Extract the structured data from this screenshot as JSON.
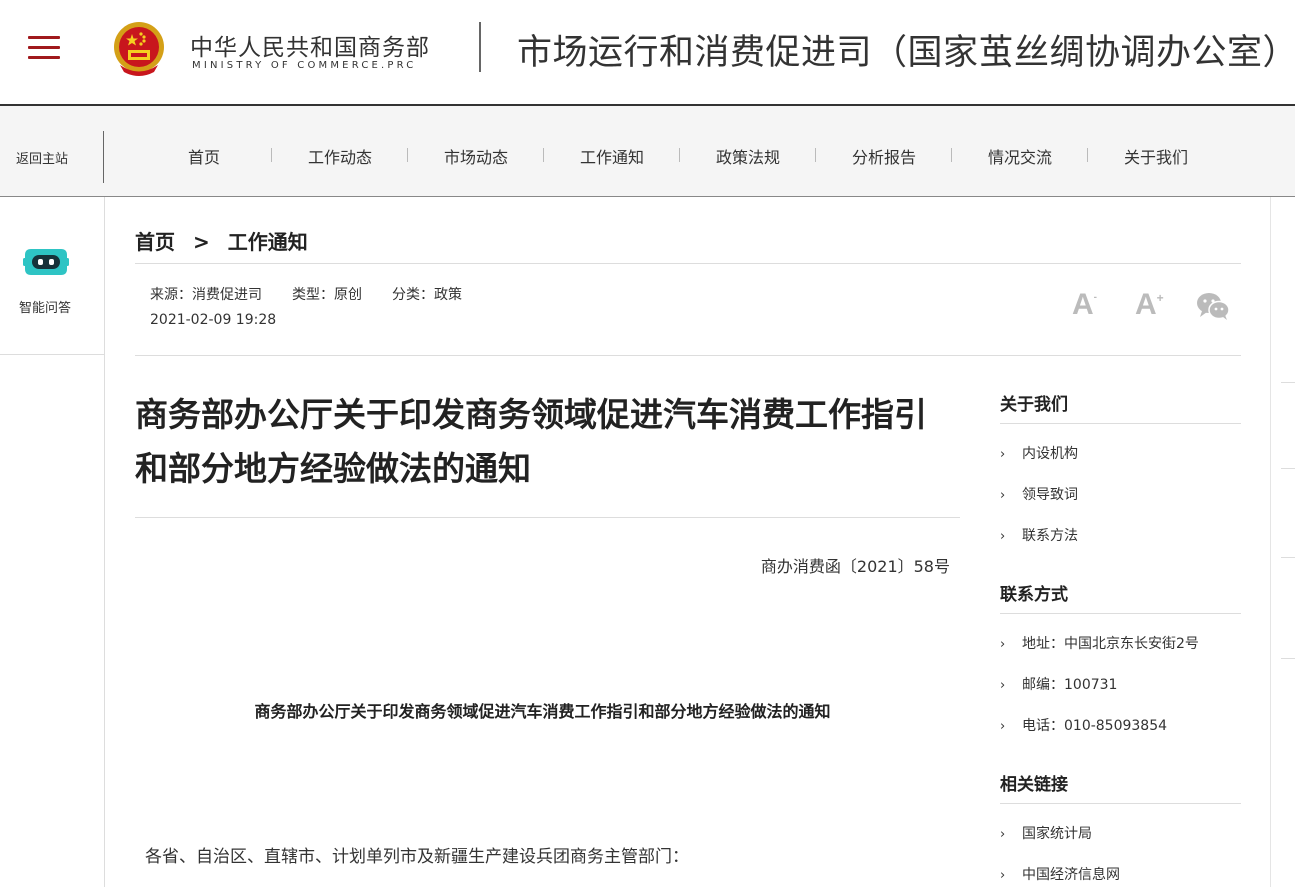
{
  "header": {
    "ministry_cn": "中华人民共和国商务部",
    "ministry_en": "MINISTRY OF COMMERCE.PRC",
    "department_title": "市场运行和消费促进司（国家茧丝绸协调办公室）",
    "menu_icon": "hamburger-icon",
    "emblem_icon": "national-emblem-icon"
  },
  "nav": {
    "back_home": "返回主站",
    "items": [
      "首页",
      "工作动态",
      "市场动态",
      "工作通知",
      "政策法规",
      "分析报告",
      "情况交流",
      "关于我们"
    ]
  },
  "side": {
    "ai_label": "智能问答",
    "ai_icon": "robot-icon"
  },
  "breadcrumb": {
    "home": "首页",
    "separator": ">",
    "current": "工作通知"
  },
  "meta": {
    "source": "来源：消费促进司",
    "type": "类型：原创",
    "category": "分类：政策",
    "date": "2021-02-09 19:28",
    "font_small_label": "A",
    "font_small_sup": "-",
    "font_large_label": "A",
    "font_large_sup": "+",
    "share_icon": "wechat-icon"
  },
  "article": {
    "title": "商务部办公厅关于印发商务领域促进汽车消费工作指引和部分地方经验做法的通知",
    "doc_number": "商办消费函〔2021〕58号",
    "subtitle": "商务部办公厅关于印发商务领域促进汽车消费工作指引和部分地方经验做法的通知",
    "body_first": "各省、自治区、直辖市、计划单列市及新疆生产建设兵团商务主管部门："
  },
  "sidebar": {
    "about": {
      "heading": "关于我们",
      "items": [
        "内设机构",
        "领导致词",
        "联系方法"
      ]
    },
    "contact": {
      "heading": "联系方式",
      "items": [
        "地址：中国北京东长安街2号",
        "邮编：100731",
        "电话：010-85093854"
      ]
    },
    "links": {
      "heading": "相关链接",
      "items": [
        "国家统计局",
        "中国经济信息网"
      ]
    }
  },
  "colors": {
    "brand_red": "#a0191d",
    "ai_teal": "#2ec4c4",
    "tool_gray": "#bbbbbb"
  }
}
